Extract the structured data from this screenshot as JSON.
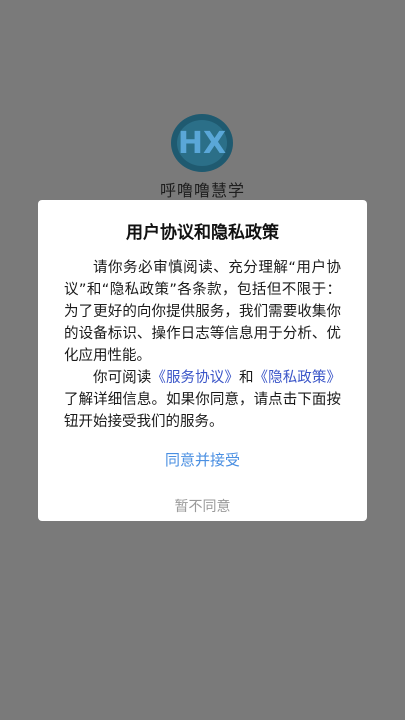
{
  "app": {
    "name": "呼噜噜慧学",
    "logo_colors": {
      "ring": "#1f5a70",
      "text": "#5aa7d8"
    }
  },
  "dialog": {
    "title": "用户协议和隐私政策",
    "paragraph1": "请你务必审慎阅读、充分理解“用户协议”和“隐私政策”各条款，包括但不限于：为了更好的向你提供服务，我们需要收集你的设备标识、操作日志等信息用于分析、优化应用性能。",
    "paragraph2": {
      "prefix": "你可阅读",
      "link_service": "《服务协议》",
      "middle": "和",
      "link_privacy": "《隐私政策》",
      "suffix": "了解详细信息。如果你同意，请点击下面按钮开始接受我们的服务。"
    },
    "agree_label": "同意并接受",
    "decline_label": "暂不同意"
  },
  "colors": {
    "overlay_background": "#7a7a7a",
    "link": "#3a55c8",
    "agree": "#4a8fe2",
    "decline": "#9a9a9a"
  }
}
